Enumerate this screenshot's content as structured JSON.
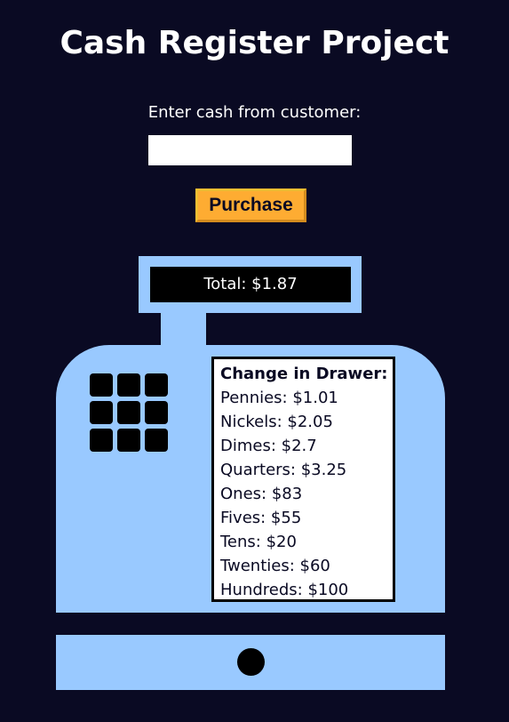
{
  "page": {
    "title": "Cash Register Project"
  },
  "form": {
    "cash_label": "Enter cash from customer:",
    "cash_value": "",
    "purchase_label": "Purchase"
  },
  "register": {
    "total_display": "Total: $1.87",
    "drawer": {
      "title": "Change in Drawer:",
      "items": [
        {
          "text": "Pennies: $1.01"
        },
        {
          "text": "Nickels: $2.05"
        },
        {
          "text": "Dimes: $2.7"
        },
        {
          "text": "Quarters: $3.25"
        },
        {
          "text": "Ones: $83"
        },
        {
          "text": "Fives: $55"
        },
        {
          "text": "Tens: $20"
        },
        {
          "text": "Twenties: $60"
        },
        {
          "text": "Hundreds: $100"
        }
      ]
    }
  },
  "colors": {
    "background": "#0a0a23",
    "register": "#99c9ff",
    "button": "#feac32",
    "screen": "#000000"
  }
}
